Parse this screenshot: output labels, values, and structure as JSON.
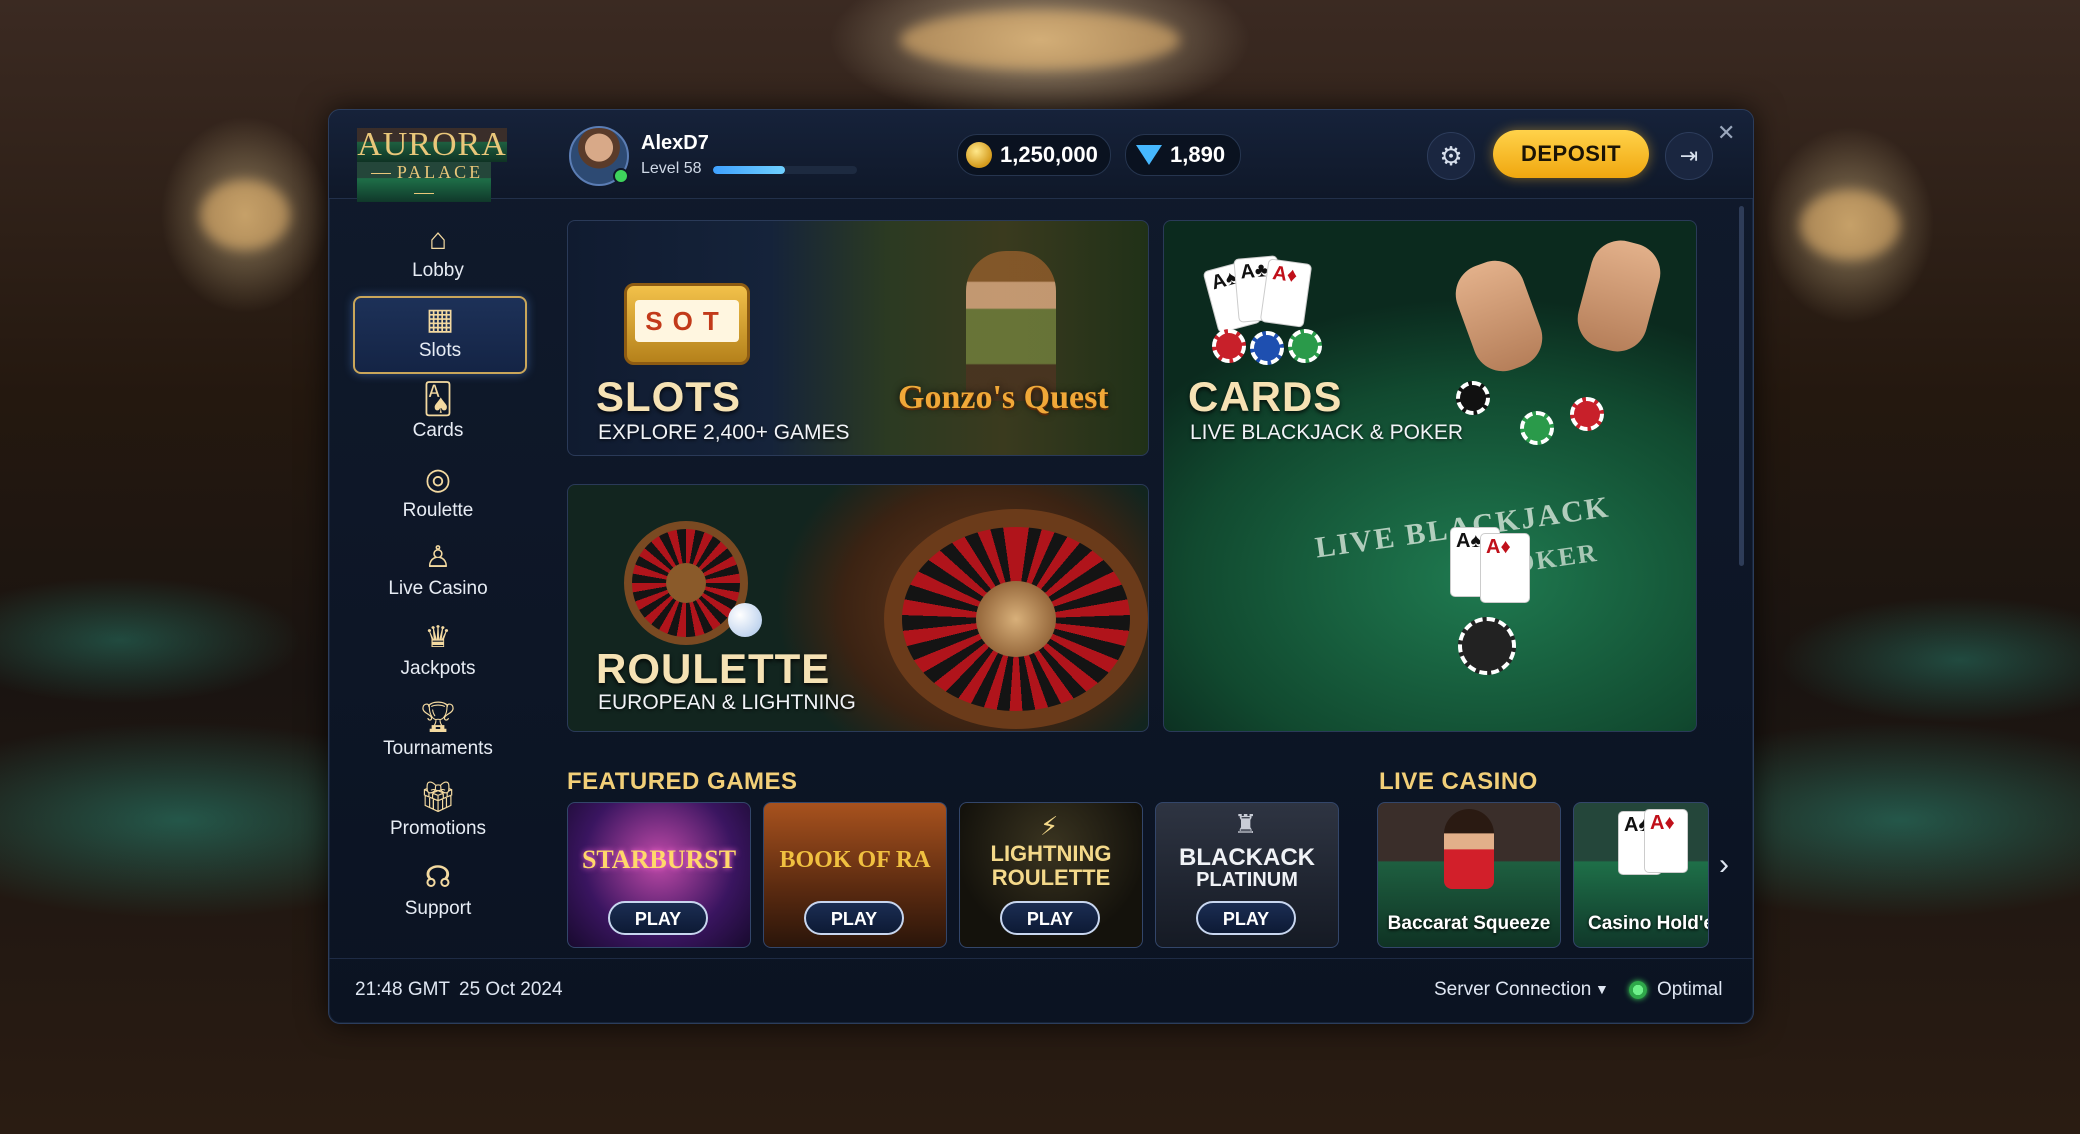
{
  "brand": {
    "line1": "AURORA",
    "line2": "PALACE"
  },
  "user": {
    "name": "AlexD7",
    "level": "Level 58",
    "xp_fraction": 0.5
  },
  "wallet": {
    "coins": "1,250,000",
    "gems": "1,890"
  },
  "header": {
    "deposit_label": "DEPOSIT"
  },
  "icons": {
    "settings": "gear-icon",
    "exit": "exit-icon",
    "close": "close-icon",
    "coin": "coin-icon",
    "gem": "gem-icon"
  },
  "sidebar": {
    "items": [
      {
        "label": "Lobby",
        "icon": "home-icon",
        "active": false
      },
      {
        "label": "Slots",
        "icon": "slot-machine-icon",
        "active": true
      },
      {
        "label": "Cards",
        "icon": "cards-icon",
        "active": false
      },
      {
        "label": "Roulette",
        "icon": "roulette-icon",
        "active": false
      },
      {
        "label": "Live Casino",
        "icon": "dealer-icon",
        "active": false
      },
      {
        "label": "Jackpots",
        "icon": "jackpot-icon",
        "active": false
      },
      {
        "label": "Tournaments",
        "icon": "trophy-icon",
        "active": false
      },
      {
        "label": "Promotions",
        "icon": "gift-icon",
        "active": false
      },
      {
        "label": "Support",
        "icon": "headset-icon",
        "active": false
      }
    ]
  },
  "tiles": {
    "slots": {
      "title": "SLOTS",
      "subtitle": "EXPLORE 2,400+ GAMES",
      "art_text": "SOT",
      "game_logo": "Gonzo's Quest"
    },
    "cards": {
      "title": "CARDS",
      "subtitle": "LIVE BLACKJACK & POKER",
      "felt_line1": "LIVE BLACKJACK",
      "felt_line2": "& POKER"
    },
    "roulette": {
      "title": "ROULETTE",
      "subtitle": "EUROPEAN & LIGHTNING"
    }
  },
  "featured": {
    "heading": "FEATURED GAMES",
    "games": [
      {
        "name": "STARBURST",
        "play": "PLAY"
      },
      {
        "name": "BOOK OF RA",
        "play": "PLAY"
      },
      {
        "name_line1": "LIGHTNING",
        "name_line2": "ROULETTE",
        "play": "PLAY"
      },
      {
        "name_line1": "BLACKACK",
        "name_line2": "PLATINUM",
        "play": "PLAY"
      }
    ]
  },
  "live_casino": {
    "heading": "LIVE CASINO",
    "tables": [
      {
        "name": "Baccarat Squeeze"
      },
      {
        "name": "Casino Hold'e"
      }
    ]
  },
  "footer": {
    "time": "21:48 GMT",
    "date": "25 Oct 2024",
    "server_label": "Server Connection",
    "server_status": "Optimal",
    "status_color": "#3ed35c"
  },
  "colors": {
    "accent_gold": "#f2cf78",
    "deposit": "#f5b820",
    "window_bg": "#0b1322"
  }
}
